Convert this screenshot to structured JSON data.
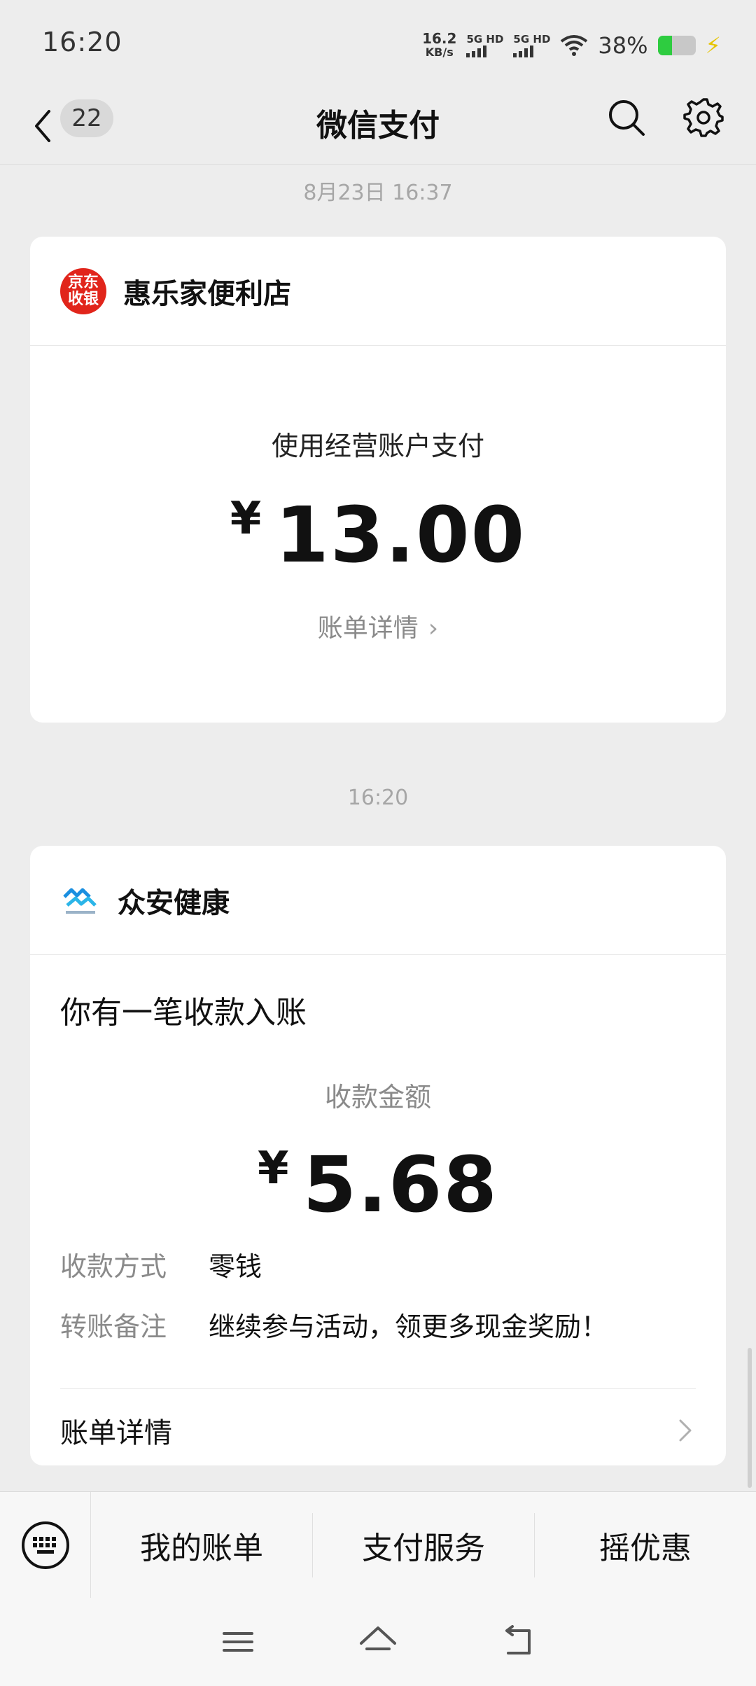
{
  "status_bar": {
    "time": "16:20",
    "net_speed_value": "16.2",
    "net_speed_unit": "KB/s",
    "sim1": "5G HD",
    "sim2": "5G HD",
    "battery_pct": "38%"
  },
  "nav": {
    "unread_count": "22",
    "title": "微信支付"
  },
  "messages": [
    {
      "timestamp": "8月23日 16:37",
      "merchant": "惠乐家便利店",
      "logo_text_line1": "京东",
      "logo_text_line2": "收银",
      "description": "使用经营账户支付",
      "currency": "¥",
      "amount": "13.00",
      "detail_link": "账单详情"
    },
    {
      "timestamp": "16:20",
      "merchant": "众安健康",
      "title": "你有一笔收款入账",
      "amount_label": "收款金额",
      "currency": "¥",
      "amount": "5.68",
      "rows": [
        {
          "key": "收款方式",
          "value": "零钱"
        },
        {
          "key": "转账备注",
          "value": "继续参与活动，领更多现金奖励！"
        }
      ],
      "detail_link": "账单详情"
    }
  ],
  "bottom_menu": {
    "items": [
      "我的账单",
      "支付服务",
      "摇优惠"
    ]
  },
  "colors": {
    "background": "#ededed",
    "card": "#ffffff",
    "jd_red": "#e1251b",
    "zhongan_blue": "#1a8fe0"
  }
}
